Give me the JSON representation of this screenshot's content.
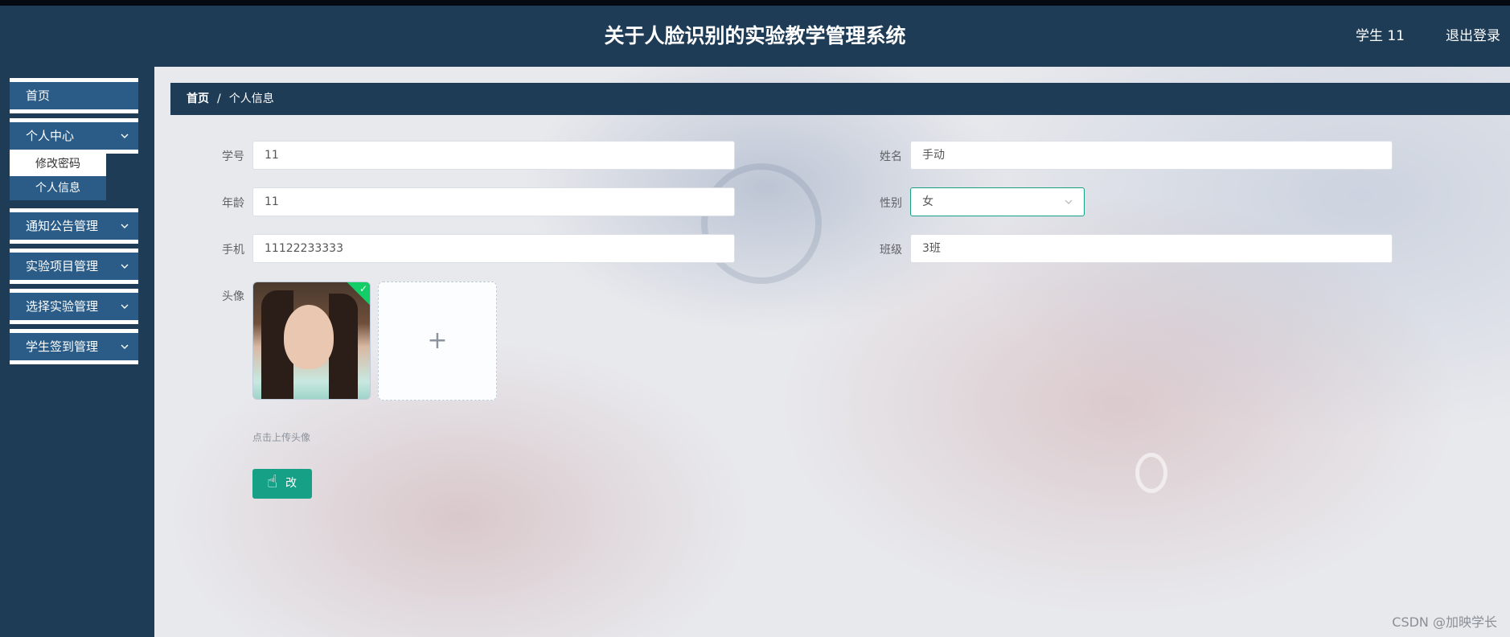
{
  "header": {
    "title": "关于人脸识别的实验教学管理系统",
    "user": "学生 11",
    "logout": "退出登录"
  },
  "sidebar": {
    "items": [
      {
        "label": "首页",
        "has_children": false
      },
      {
        "label": "个人中心",
        "has_children": true,
        "expanded": true,
        "children": [
          {
            "label": "修改密码",
            "active": false
          },
          {
            "label": "个人信息",
            "active": true
          }
        ]
      },
      {
        "label": "通知公告管理",
        "has_children": true
      },
      {
        "label": "实验项目管理",
        "has_children": true
      },
      {
        "label": "选择实验管理",
        "has_children": true
      },
      {
        "label": "学生签到管理",
        "has_children": true
      }
    ]
  },
  "breadcrumb": {
    "home": "首页",
    "separator": "/",
    "current": "个人信息"
  },
  "form": {
    "student_id": {
      "label": "学号",
      "value": "11"
    },
    "name": {
      "label": "姓名",
      "value": "手动"
    },
    "age": {
      "label": "年龄",
      "value": "11"
    },
    "gender": {
      "label": "性别",
      "value": "女"
    },
    "phone": {
      "label": "手机",
      "value": "11122233333"
    },
    "class": {
      "label": "班级",
      "value": "3班"
    },
    "avatar": {
      "label": "头像",
      "hint": "点击上传头像",
      "add_icon": "+"
    },
    "submit_label": "改"
  },
  "watermark": "CSDN @加映学长",
  "colors": {
    "header_bg": "#1f3c56",
    "menu_bg": "#2a5c87",
    "accent": "#16a085",
    "success_check": "#13ce66"
  },
  "icons": {
    "chevron": "chevron-down-icon",
    "upload": "plus-icon",
    "cursor": "hand-pointer-icon",
    "check": "check-icon"
  }
}
